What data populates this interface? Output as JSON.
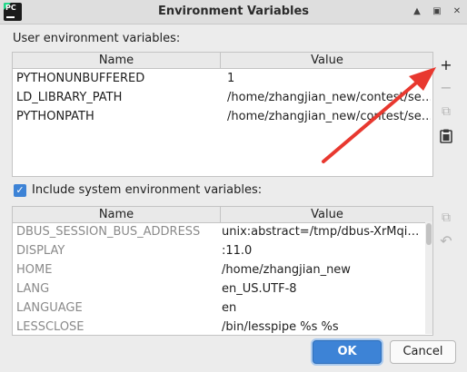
{
  "window": {
    "title": "Environment Variables",
    "app_icon_text": "PC",
    "controls": [
      "▲",
      "▣",
      "✕"
    ]
  },
  "user_env": {
    "label": "User environment variables:",
    "columns": [
      "Name",
      "Value"
    ],
    "rows": [
      {
        "name": "PYTHONUNBUFFERED",
        "value": "1"
      },
      {
        "name": "LD_LIBRARY_PATH",
        "value": "/home/zhangjian_new/contest/se…"
      },
      {
        "name": "PYTHONPATH",
        "value": "/home/zhangjian_new/contest/se…"
      }
    ],
    "tools": {
      "add": "+",
      "remove": "−",
      "copy": "⧉",
      "paste": "📋"
    }
  },
  "system_env": {
    "include_label": "Include system environment variables:",
    "include_checked": true,
    "columns": [
      "Name",
      "Value"
    ],
    "rows": [
      {
        "name": "DBUS_SESSION_BUS_ADDRESS",
        "value": "unix:abstract=/tmp/dbus-XrMqi…"
      },
      {
        "name": "DISPLAY",
        "value": ":11.0"
      },
      {
        "name": "HOME",
        "value": "/home/zhangjian_new"
      },
      {
        "name": "LANG",
        "value": "en_US.UTF-8"
      },
      {
        "name": "LANGUAGE",
        "value": "en"
      },
      {
        "name": "LESSCLOSE",
        "value": "/bin/lesspipe %s %s"
      }
    ],
    "tools": {
      "copy": "⧉",
      "revert": "↶"
    }
  },
  "buttons": {
    "ok": "OK",
    "cancel": "Cancel"
  },
  "colors": {
    "accent": "#3d83d6",
    "arrow": "#e8382f"
  }
}
